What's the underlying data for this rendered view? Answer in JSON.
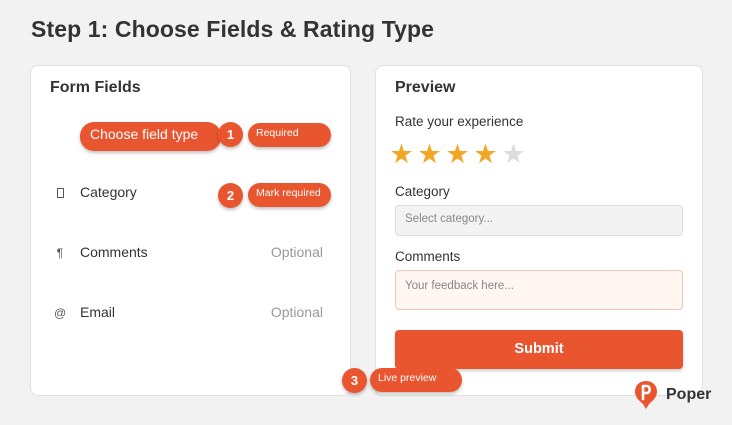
{
  "page": {
    "title": "Step 1: Choose Fields & Rating Type"
  },
  "form_fields": {
    "heading": "Form Fields",
    "choose_label": "Choose field type",
    "badge_1": "1",
    "required_label": "Required",
    "badge_2": "2",
    "mark_required_label": "Mark required",
    "fields": [
      {
        "icon": "checkbox-icon",
        "label": "Category",
        "status": ""
      },
      {
        "icon": "pilcrow-icon",
        "label": "Comments",
        "status": "Optional"
      },
      {
        "icon": "at-icon",
        "label": "Email",
        "status": "Optional"
      }
    ],
    "icon_glyphs": {
      "pilcrow": "¶",
      "at": "@"
    }
  },
  "preview": {
    "heading": "Preview",
    "prompt": "Rate your experience",
    "rating": {
      "value": 4,
      "max": 5
    },
    "category_label": "Category",
    "category_placeholder": "Select category...",
    "comments_label": "Comments",
    "comments_placeholder": "Your feedback here...",
    "submit_label": "Submit"
  },
  "callout": {
    "badge_3": "3",
    "live_preview_label": "Live preview"
  },
  "brand": {
    "name": "Poper"
  },
  "colors": {
    "accent": "#e9552f",
    "star_on": "#f3a623",
    "star_off": "#dddddd",
    "background": "#f2f2f2"
  }
}
